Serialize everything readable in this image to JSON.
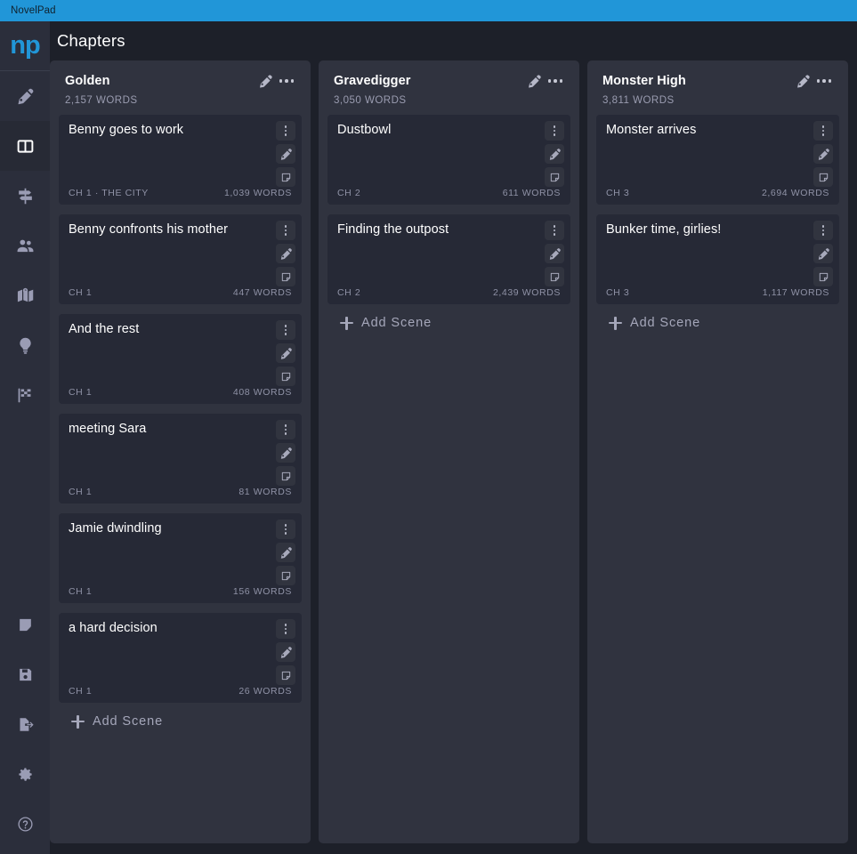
{
  "window": {
    "title": "NovelPad"
  },
  "sidebar": {
    "logo": "np",
    "items": [
      {
        "name": "write",
        "icon": "pen-nib-icon",
        "active": false
      },
      {
        "name": "chapters",
        "icon": "board-columns-icon",
        "active": true
      },
      {
        "name": "plot",
        "icon": "signpost-icon",
        "active": false
      },
      {
        "name": "characters",
        "icon": "people-icon",
        "active": false
      },
      {
        "name": "locations",
        "icon": "map-icon",
        "active": false
      },
      {
        "name": "ideas",
        "icon": "lightbulb-icon",
        "active": false
      },
      {
        "name": "goals",
        "icon": "checkered-flag-icon",
        "active": false
      }
    ],
    "bottom_items": [
      {
        "name": "notes",
        "icon": "sticky-note-icon"
      },
      {
        "name": "save",
        "icon": "floppy-disk-icon"
      },
      {
        "name": "export",
        "icon": "file-export-icon"
      },
      {
        "name": "settings",
        "icon": "gear-icon"
      },
      {
        "name": "help",
        "icon": "question-circle-icon"
      }
    ]
  },
  "header": {
    "title": "Chapters"
  },
  "board": {
    "add_scene_label": "Add Scene",
    "columns": [
      {
        "title": "Golden",
        "words": "2,157 WORDS",
        "edit_icon": "pen-nib-icon",
        "menu_icon": "ellipsis-horizontal-icon",
        "scenes": [
          {
            "title": "Benny goes to work",
            "meta": "CH 1 · THE CITY",
            "words": "1,039 WORDS"
          },
          {
            "title": "Benny confronts his mother",
            "meta": "CH 1",
            "words": "447 WORDS"
          },
          {
            "title": "And the rest",
            "meta": "CH 1",
            "words": "408 WORDS"
          },
          {
            "title": "meeting Sara",
            "meta": "CH 1",
            "words": "81 WORDS"
          },
          {
            "title": "Jamie dwindling",
            "meta": "CH 1",
            "words": "156 WORDS"
          },
          {
            "title": "a hard decision",
            "meta": "CH 1",
            "words": "26 WORDS"
          }
        ]
      },
      {
        "title": "Gravedigger",
        "words": "3,050 WORDS",
        "edit_icon": "pen-nib-icon",
        "menu_icon": "ellipsis-horizontal-icon",
        "scenes": [
          {
            "title": "Dustbowl",
            "meta": "CH 2",
            "words": "611 WORDS"
          },
          {
            "title": "Finding the outpost",
            "meta": "CH 2",
            "words": "2,439 WORDS"
          }
        ]
      },
      {
        "title": "Monster High",
        "words": "3,811 WORDS",
        "edit_icon": "pen-nib-icon",
        "menu_icon": "ellipsis-horizontal-icon",
        "scenes": [
          {
            "title": "Monster arrives",
            "meta": "CH 3",
            "words": "2,694 WORDS"
          },
          {
            "title": "Bunker time, girlies!",
            "meta": "CH 3",
            "words": "1,117 WORDS"
          }
        ]
      }
    ]
  },
  "card_actions": {
    "menu_icon": "ellipsis-vertical-icon",
    "write_icon": "pen-nib-icon",
    "note_icon": "sticky-note-icon"
  },
  "colors": {
    "titlebar": "#2196d8",
    "accent": "#2196d8",
    "sidebar": "#2b2e3b",
    "page_bg": "#1d2029",
    "column_bg": "#30333f",
    "card_bg": "#262936"
  }
}
